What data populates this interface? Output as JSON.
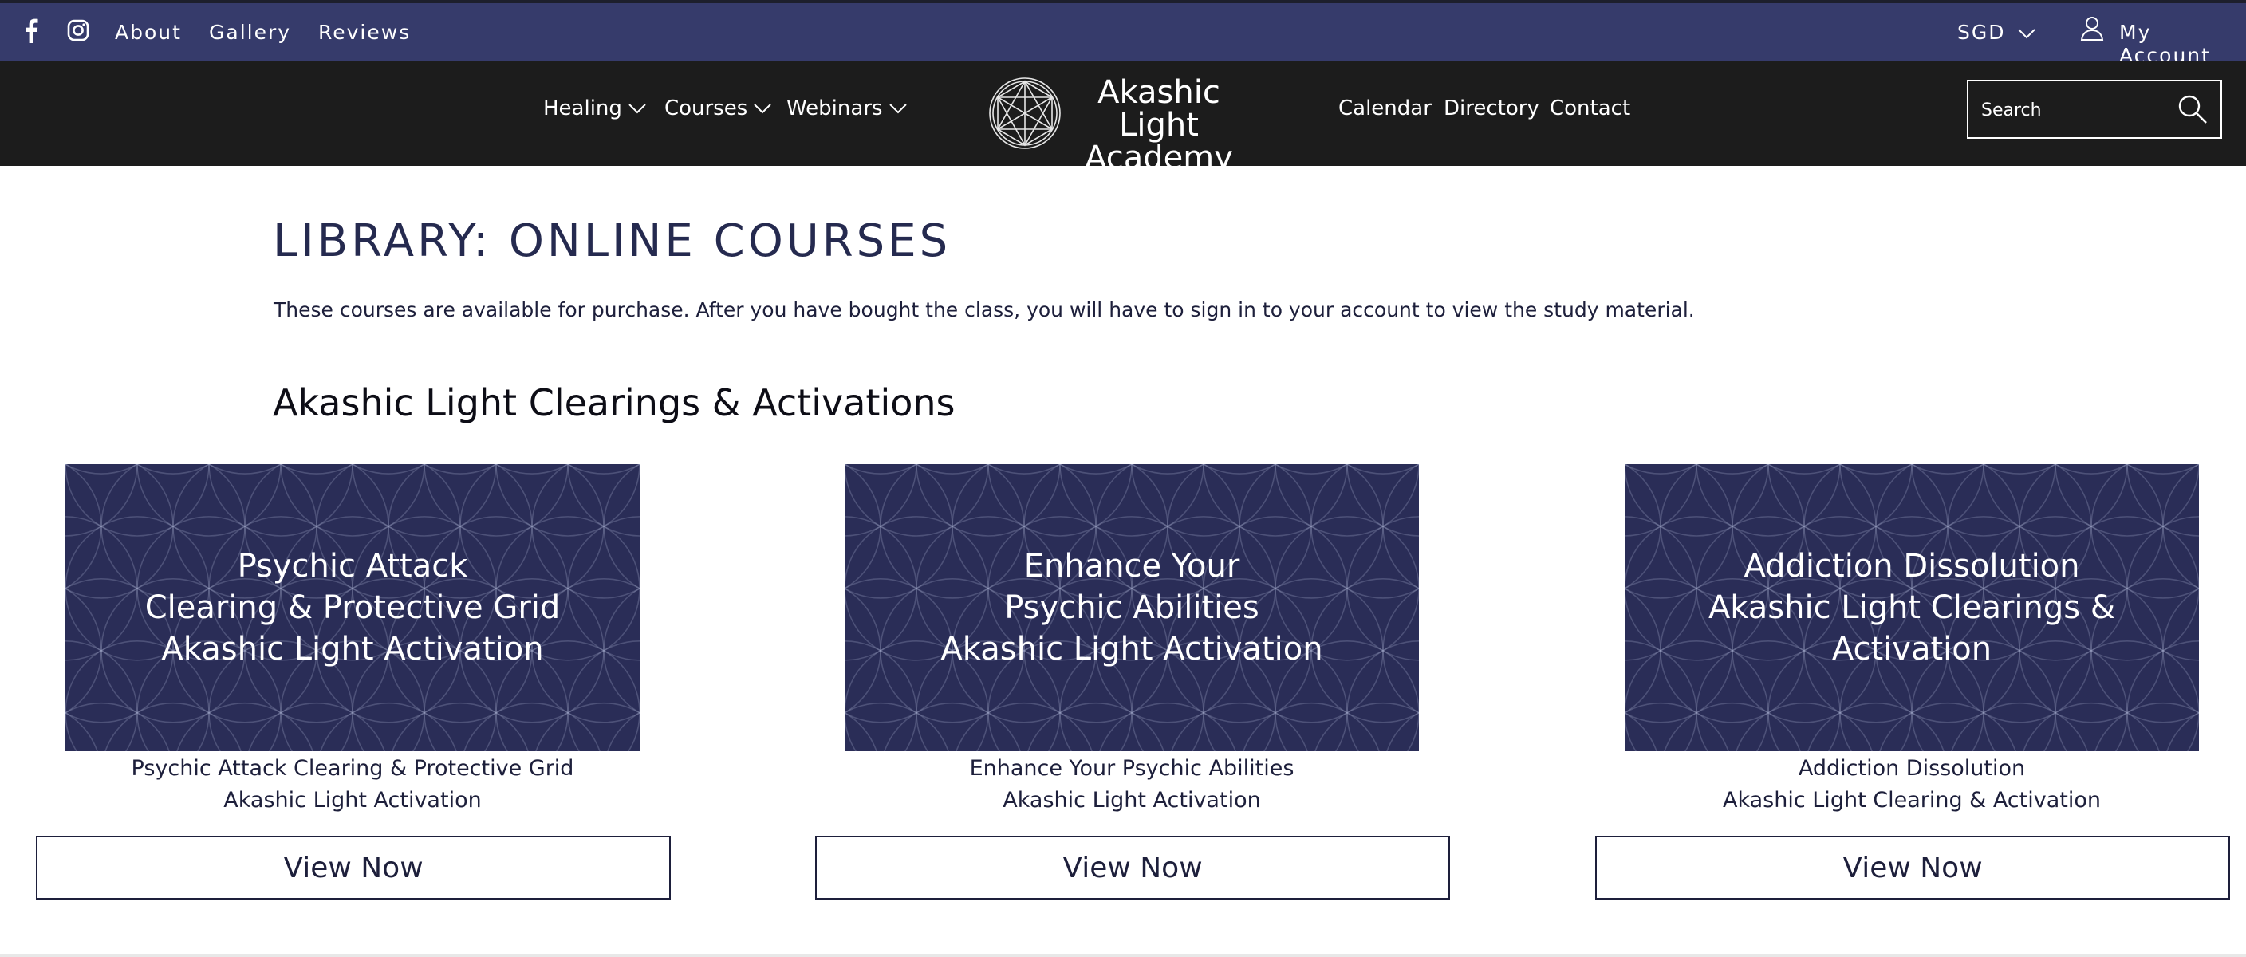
{
  "topbar": {
    "links": [
      "About",
      "Gallery",
      "Reviews"
    ],
    "currency": "SGD",
    "account_label": "My Account",
    "icons": [
      "facebook-icon",
      "instagram-icon",
      "chevron-down-icon",
      "user-icon"
    ]
  },
  "nav": {
    "left_items": [
      {
        "label": "Healing",
        "has_dropdown": true
      },
      {
        "label": "Courses",
        "has_dropdown": true
      },
      {
        "label": "Webinars",
        "has_dropdown": true
      }
    ],
    "logo": {
      "line1": "Akashic Light",
      "line2": "Academy"
    },
    "right_items": [
      "Calendar",
      "Directory",
      "Contact"
    ],
    "search": {
      "placeholder": "Search",
      "icon": "search-icon"
    }
  },
  "main": {
    "title": "LIBRARY: ONLINE COURSES",
    "intro": "These courses are available for purchase. After you have bought the class, you will have to sign in to your account to view the study material.",
    "section_title": "Akashic Light Clearings & Activations",
    "courses": [
      {
        "image_text": "Psychic Attack\nClearing & Protective Grid\nAkashic Light Activation",
        "caption": "Psychic Attack Clearing & Protective Grid\nAkashic Light Activation",
        "button": "View Now"
      },
      {
        "image_text": "Enhance Your\nPsychic Abilities\nAkashic Light Activation",
        "caption": "Enhance Your Psychic Abilities\nAkashic Light Activation",
        "button": "View Now"
      },
      {
        "image_text": "Addiction Dissolution\nAkashic Light Clearings & Activation",
        "caption": "Addiction Dissolution\nAkashic Light Clearing & Activation",
        "button": "View Now"
      }
    ]
  },
  "colors": {
    "topbar_bg": "#363b6b",
    "navbar_bg": "#1c1c1c",
    "accent_navy": "#252a4f",
    "card_bg": "#2a2d57"
  }
}
